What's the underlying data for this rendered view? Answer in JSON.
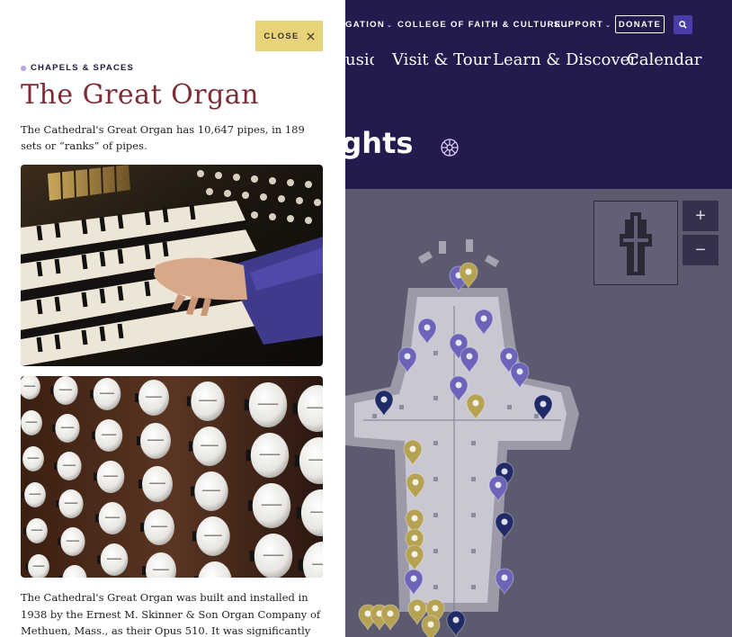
{
  "header": {
    "utility_nav": [
      {
        "label": "GATION",
        "has_dropdown": true
      },
      {
        "label": "COLLEGE OF FAITH & CULTURE",
        "has_dropdown": true
      },
      {
        "label": "SUPPORT",
        "has_dropdown": true
      }
    ],
    "donate_label": "DONATE",
    "search_icon": "search-icon",
    "main_nav": [
      "usic",
      "Visit & Tour",
      "Learn & Discover",
      "Calendar"
    ],
    "page_heading": "Highlights",
    "page_heading_icon": "rosette-icon"
  },
  "panel": {
    "close_label": "CLOSE",
    "close_icon": "close-icon",
    "eyebrow": "CHAPELS & SPACES",
    "title": "The Great Organ",
    "intro": "The Cathedral's Great Organ has 10,647 pipes, in 189 sets or “ranks” of pipes.",
    "images": [
      {
        "description": "organ-keyboard-photo"
      },
      {
        "description": "organ-stops-photo"
      }
    ],
    "body": "The Cathedral's Great Organ was built and installed in 1938 by the Ernest M. Skinner & Son Organ Company of Methuen, Mass., as their Opus 510. It was significantly altered and expanded"
  },
  "map": {
    "zoom_in_label": "+",
    "zoom_out_label": "−",
    "marker_colors": {
      "chapel": "#6d63b8",
      "art": "#b5a253",
      "feature": "#1f2a66"
    }
  },
  "colors": {
    "header_bg": "#241a4d",
    "accent_gold": "#e8d27a",
    "title_red": "#7d2c36",
    "eyebrow_dot": "#b7a3ea"
  }
}
